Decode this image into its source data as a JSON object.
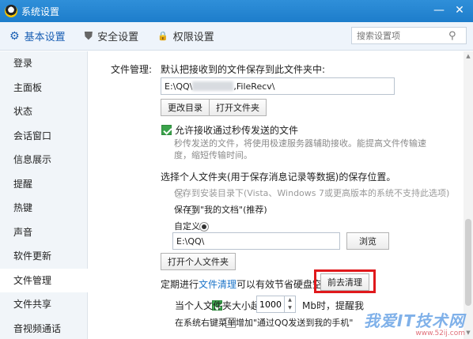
{
  "window": {
    "title": "系统设置",
    "minimize": "—",
    "close": "✕"
  },
  "tabs": [
    {
      "label": "基本设置",
      "icon": "gear-icon",
      "glyph": "⚙"
    },
    {
      "label": "安全设置",
      "icon": "shield-icon",
      "glyph": "⛊"
    },
    {
      "label": "权限设置",
      "icon": "lock-icon",
      "glyph": "🔒"
    }
  ],
  "search": {
    "placeholder": "搜索设置项",
    "glyph": "⚲"
  },
  "sidebar": {
    "items": [
      "登录",
      "主面板",
      "状态",
      "会话窗口",
      "信息展示",
      "提醒",
      "热键",
      "声音",
      "软件更新",
      "文件管理",
      "文件共享",
      "音视频通话"
    ],
    "active": "文件管理"
  },
  "file_management": {
    "section_label": "文件管理:",
    "receive_label": "默认把接收到的文件保存到此文件夹中:",
    "receive_path_prefix": "E:\\QQ\\",
    "receive_path_suffix": ",FileRecv\\",
    "change_dir_button": "更改目录",
    "open_folder_button": "打开文件夹",
    "allow_instant": {
      "label": "允许接收通过秒传发送的文件",
      "checked": true,
      "desc_line1": "秒传发送的文件，将使用极速服务器辅助接收。能提高文件传输速",
      "desc_line2": "度，缩短传输时间。"
    },
    "personal_folder_label": "选择个人文件夹(用于保存消息记录等数据)的保存位置。",
    "options": [
      {
        "label": "保存到安装目录下(Vista、Windows 7或更高版本的系统不支持此选项)",
        "disabled": true,
        "selected": false
      },
      {
        "label": "保存到\"我的文档\"(推荐)",
        "disabled": false,
        "selected": false
      },
      {
        "label": "自定义",
        "disabled": false,
        "selected": true
      }
    ],
    "custom_path": "E:\\QQ\\",
    "browse_button": "浏览",
    "open_personal_button": "打开个人文件夹",
    "cleanup_text_pre": "定期进行",
    "cleanup_link": "文件清理",
    "cleanup_text_post": "可以有效节省硬盘空间。",
    "cleanup_button": "前去清理",
    "size_limit": {
      "label_pre": "当个人文件夹大小超过",
      "value": "1000",
      "label_post": "Mb时，提醒我",
      "checked": true
    },
    "context_menu": {
      "label": "在系统右键菜单增加\"通过QQ发送到我的手机\"",
      "checked": false
    }
  },
  "watermark": {
    "main": "我爱IT技术网",
    "sub": "www.52ij.com"
  }
}
